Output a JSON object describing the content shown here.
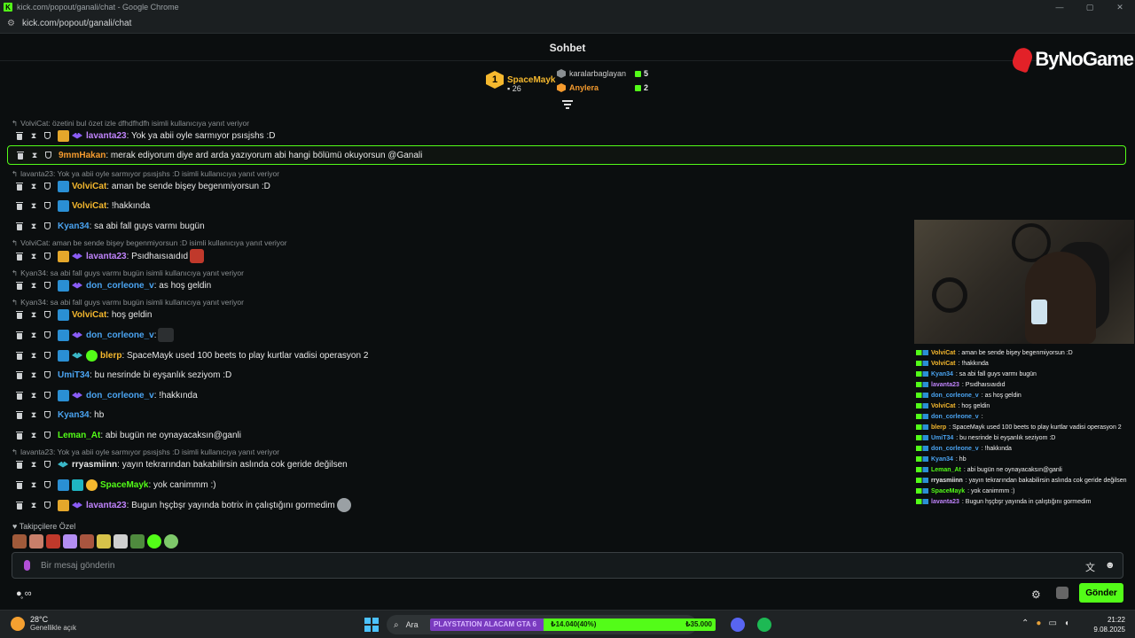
{
  "window": {
    "title": "kick.com/popout/ganali/chat - Google Chrome",
    "url": "kick.com/popout/ganali/chat",
    "minimize": "—",
    "maximize": "▢",
    "close": "✕"
  },
  "chat": {
    "title": "Sohbet"
  },
  "brand": {
    "name": "ByNoGame"
  },
  "leaderboard": {
    "first": {
      "rank": "1",
      "name": "SpaceMayk",
      "count": "26"
    },
    "rows": [
      {
        "name": "karalarbaglayan",
        "count": "5"
      },
      {
        "name": "Anylera",
        "count": "2"
      }
    ]
  },
  "messages": [
    {
      "reply": "VolviCat: özetini bul özet izle dfhdfhdfh isimli kullanıcıya yanıt veriyor",
      "user": "lavanta23",
      "color": "#c084fc",
      "text": ": Yok ya abii oyle sarmıyor psısjshs :D"
    },
    {
      "user": "9mmHakan",
      "color": "#f59b2e",
      "text": ": merak ediyorum diye ard arda yazıyorum abi hangi bölümü okuyorsun @Ganali"
    },
    {
      "reply": "lavanta23: Yok ya abii oyle sarmıyor psısjshs :D isimli kullanıcıya yanıt veriyor",
      "user": "VolviCat",
      "color": "#f5b82e",
      "text": ": aman be sende bişey begenmiyorsun :D"
    },
    {
      "user": "VolviCat",
      "color": "#f5b82e",
      "text": ": !hakkında"
    },
    {
      "user": "Kyan34",
      "color": "#4aa3f0",
      "text": ": sa abi fall guys varmı bugün"
    },
    {
      "reply": "VolviCat: aman be sende bişey begenmiyorsun :D isimli kullanıcıya yanıt veriyor",
      "user": "lavanta23",
      "color": "#c084fc",
      "text": ": Psıdhaısıaıdıd"
    },
    {
      "reply": "Kyan34: sa abi fall guys varmı bugün isimli kullanıcıya yanıt veriyor",
      "user": "don_corleone_v",
      "color": "#4aa3f0",
      "text": ": as hoş geldin"
    },
    {
      "reply": "Kyan34: sa abi fall guys varmı bugün isimli kullanıcıya yanıt veriyor",
      "user": "VolviCat",
      "color": "#f5b82e",
      "text": ": hoş geldin"
    },
    {
      "user": "don_corleone_v",
      "color": "#4aa3f0",
      "text": ":"
    },
    {
      "user": "blerp",
      "color": "#f5b82e",
      "text": ": SpaceMayk used 100 beets to play kurtlar vadisi operasyon 2"
    },
    {
      "user": "UmiT34",
      "color": "#4aa3f0",
      "text": ": bu nesrinde bi eyşanlık seziyom :D"
    },
    {
      "user": "don_corleone_v",
      "color": "#4aa3f0",
      "text": ": !hakkında"
    },
    {
      "user": "Kyan34",
      "color": "#4aa3f0",
      "text": ": hb"
    },
    {
      "user": "Leman_At",
      "color": "#53fc18",
      "text": ": abi bugün ne oynayacaksın@ganli"
    },
    {
      "reply": "lavanta23: Yok ya abii oyle sarmıyor psısjshs :D isimli kullanıcıya yanıt veriyor",
      "user": "rryasmiinn",
      "color": "#e8e8e8",
      "text": ": yayın tekrarından bakabilirsin aslında cok geride değilsen"
    },
    {
      "user": "SpaceMayk",
      "color": "#53fc18",
      "text": ": yok canimmm :)"
    },
    {
      "user": "lavanta23",
      "color": "#c084fc",
      "text": ": Bugun hşçbşr yayında botrix in çalıştığını gormedim"
    }
  ],
  "followers_label": "Takipçilere Özel",
  "input": {
    "placeholder": "Bir mesaj gönderin",
    "translate_icon": "文",
    "emoji_icon": "☻"
  },
  "bottom": {
    "send_label": "Gönder",
    "settings_icon": "⚙",
    "left_icons": "●̥ ∞"
  },
  "overlay": [
    {
      "user": "VolviCat",
      "color": "#f5b82e",
      "text": ": aman be sende bişey begenmiyorsun :D"
    },
    {
      "user": "VolviCat",
      "color": "#f5b82e",
      "text": ": !hakkında"
    },
    {
      "user": "Kyan34",
      "color": "#4aa3f0",
      "text": ": sa abi fall guys varmı bugün"
    },
    {
      "user": "lavanta23",
      "color": "#c084fc",
      "text": ": Psıdhaısıaıdıd"
    },
    {
      "user": "don_corleone_v",
      "color": "#4aa3f0",
      "text": ": as hoş geldin"
    },
    {
      "user": "VolviCat",
      "color": "#f5b82e",
      "text": ": hoş geldin"
    },
    {
      "user": "don_corleone_v",
      "color": "#4aa3f0",
      "text": ":"
    },
    {
      "user": "blerp",
      "color": "#f5b82e",
      "text": ": SpaceMayk used 100 beets to play kurtlar vadisi operasyon 2"
    },
    {
      "user": "UmiT34",
      "color": "#4aa3f0",
      "text": ": bu nesrinde bi eyşanlık seziyom :D"
    },
    {
      "user": "don_corleone_v",
      "color": "#4aa3f0",
      "text": ": !hakkında"
    },
    {
      "user": "Kyan34",
      "color": "#4aa3f0",
      "text": ": hb"
    },
    {
      "user": "Leman_At",
      "color": "#53fc18",
      "text": ": abi bugün ne oynayacaksın@ganli"
    },
    {
      "user": "rryasmiinn",
      "color": "#e8e8e8",
      "text": ": yayın tekrarından bakabilirsin aslında cok geride değilsen"
    },
    {
      "user": "SpaceMayk",
      "color": "#53fc18",
      "text": ": yok canimmm :)"
    },
    {
      "user": "lavanta23",
      "color": "#c084fc",
      "text": ": Bugun hşçbşr yayında    in çalıştığını gormedim"
    }
  ],
  "taskbar": {
    "temp": "28°C",
    "weather": "Genellikle açık",
    "search": "Ara",
    "goal_title": "PLAYSTATION ALACAM GTA 6",
    "goal_current": "₺14.040(40%)",
    "goal_target": "₺35.000",
    "goal_progress": 0.4,
    "time": "21:22",
    "date": "9.08.2025"
  },
  "colors": {
    "accent": "#53fc18",
    "background": "#0b0e0f"
  }
}
